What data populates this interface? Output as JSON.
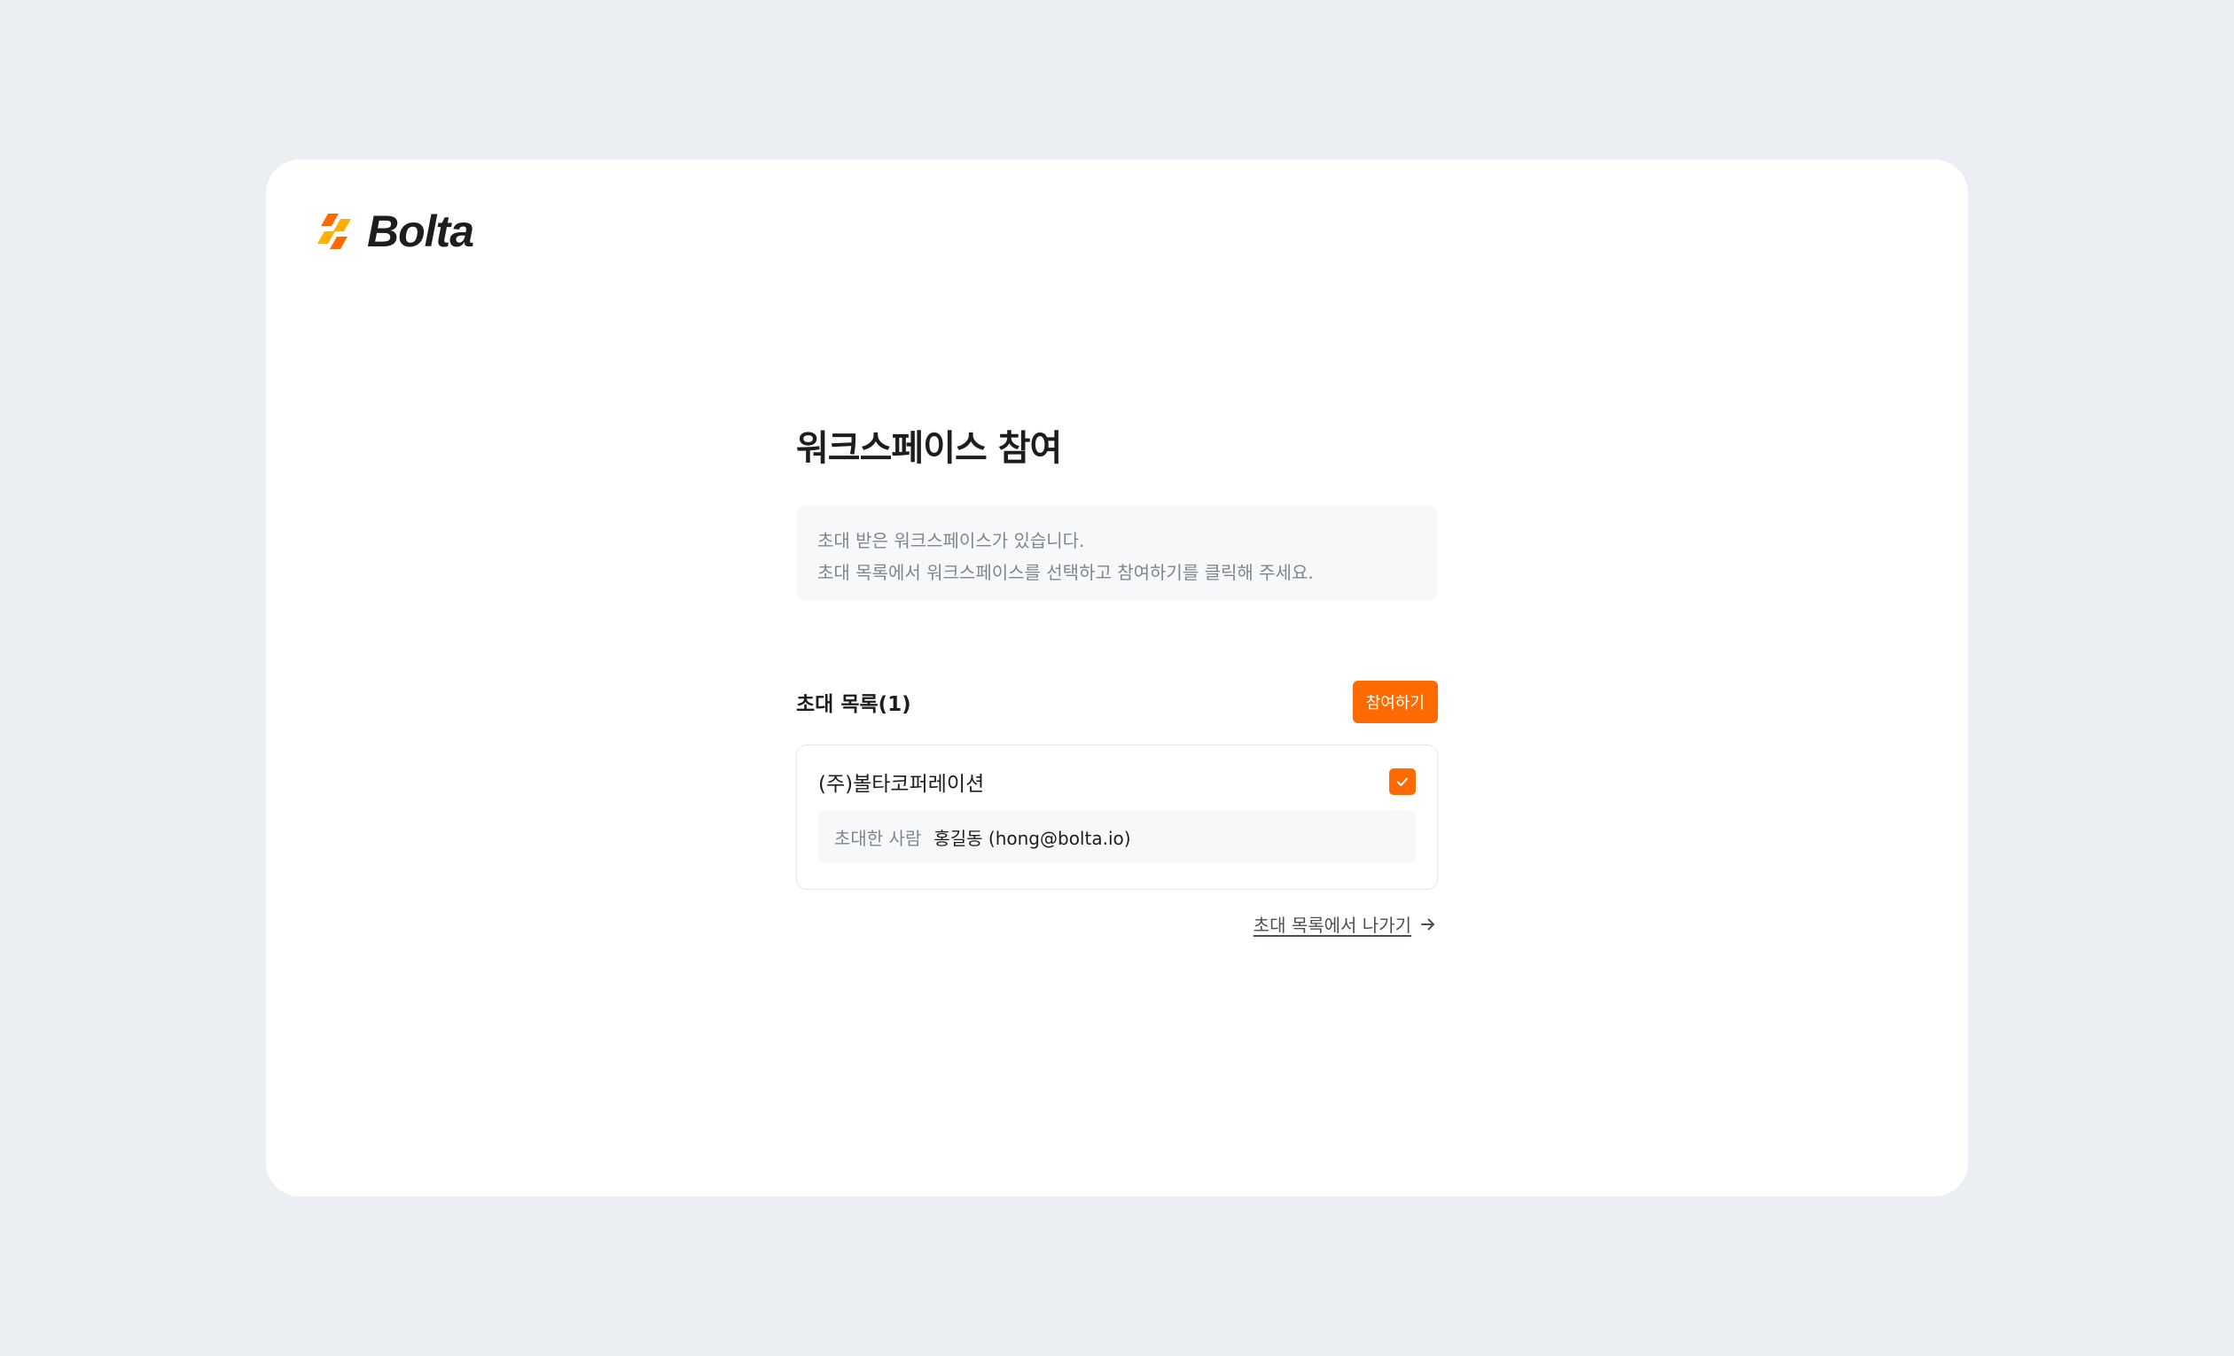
{
  "brand": {
    "logo_text": "Bolta",
    "logo_icon": "bolt-stripes-icon",
    "accent": "#ff6a00"
  },
  "page": {
    "title": "워크스페이스 참여"
  },
  "notice": {
    "line1": "초대 받은 워크스페이스가 있습니다.",
    "line2": "초대 목록에서 워크스페이스를 선택하고 참여하기를 클릭해 주세요."
  },
  "invites": {
    "title": "초대 목록(1)",
    "join_label": "참여하기",
    "items": [
      {
        "company": "(주)볼타코퍼레이션",
        "checked": true,
        "inviter_label": "초대한 사람",
        "inviter_value": "홍길동 (hong@bolta.io)"
      }
    ],
    "leave_label": "초대 목록에서 나가기"
  }
}
